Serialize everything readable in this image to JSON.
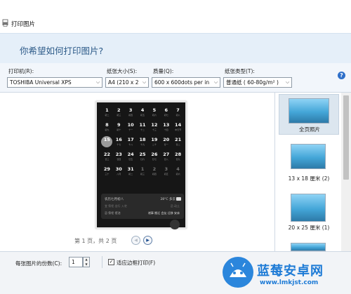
{
  "window": {
    "title": "打印图片"
  },
  "header": {
    "question": "你希望如何打印图片?"
  },
  "options": {
    "printer": {
      "label": "打印机(R):",
      "value": "TOSHIBA Universal XPS"
    },
    "paper_size": {
      "label": "纸张大小(S):",
      "value": "A4 (210 x 2"
    },
    "quality": {
      "label": "质量(Q):",
      "value": "600 x 600dots per in"
    },
    "paper_type": {
      "label": "纸张类型(T):",
      "value": "普通纸 ( 60-80g/m² )"
    }
  },
  "preview": {
    "calendar": {
      "rows": [
        [
          {
            "d": "1",
            "s": "初二"
          },
          {
            "d": "2",
            "s": "初三"
          },
          {
            "d": "3",
            "s": "初四"
          },
          {
            "d": "4",
            "s": "初五"
          },
          {
            "d": "5",
            "s": "初六"
          },
          {
            "d": "6",
            "s": "初七"
          },
          {
            "d": "7",
            "s": "初八"
          }
        ],
        [
          {
            "d": "8",
            "s": "初九"
          },
          {
            "d": "9",
            "s": "初十"
          },
          {
            "d": "10",
            "s": "十一"
          },
          {
            "d": "11",
            "s": "十二"
          },
          {
            "d": "12",
            "s": "十三"
          },
          {
            "d": "13",
            "s": "十四"
          },
          {
            "d": "14",
            "s": "中元节"
          }
        ],
        [
          {
            "d": "15",
            "s": "十六"
          },
          {
            "d": "16",
            "s": "十七"
          },
          {
            "d": "17",
            "s": "十八"
          },
          {
            "d": "18",
            "s": "十九"
          },
          {
            "d": "19",
            "s": "二十"
          },
          {
            "d": "20",
            "s": "廿一"
          },
          {
            "d": "21",
            "s": "廿二"
          }
        ],
        [
          {
            "d": "22",
            "s": "廿三"
          },
          {
            "d": "23",
            "s": "廿四"
          },
          {
            "d": "24",
            "s": "廿五"
          },
          {
            "d": "25",
            "s": "廿六"
          },
          {
            "d": "26",
            "s": "廿七"
          },
          {
            "d": "27",
            "s": "廿八"
          },
          {
            "d": "28",
            "s": "廿九"
          }
        ],
        [
          {
            "d": "29",
            "s": "三十"
          },
          {
            "d": "30",
            "s": "八月"
          },
          {
            "d": "31",
            "s": "初二"
          },
          {
            "d": "1",
            "s": "初三"
          },
          {
            "d": "2",
            "s": "初四"
          },
          {
            "d": "3",
            "s": "初五"
          },
          {
            "d": "4",
            "s": "初六"
          }
        ]
      ]
    },
    "event": {
      "title": "农历七月初八",
      "weather": "28°C 多云",
      "line1": "宜 祭祀 出行 入宅",
      "line1_right": "忌 动土",
      "line2": "忌 祭祀 馆池",
      "line2_right": "诸事 搬迁 会友 迁移 安床"
    },
    "pager": "第 1 页，共 2 页"
  },
  "thumbnails": [
    {
      "label": "全页照片"
    },
    {
      "label": "13 x 18 厘米 (2)"
    },
    {
      "label": "20 x 25 厘米 (1)"
    }
  ],
  "footer": {
    "copies_label": "每张图片的份数(C):",
    "copies_value": "1",
    "fit_label": "适应边框打印(F)",
    "fit_checked": true
  },
  "watermark": {
    "name": "蓝莓安卓网",
    "url": "www.lmkjst.com"
  },
  "colors": {
    "header_bg": "#e5eff9",
    "header_text": "#2c5a88",
    "help_icon": "#2e6fc9",
    "watermark": "#1e7bd6"
  }
}
